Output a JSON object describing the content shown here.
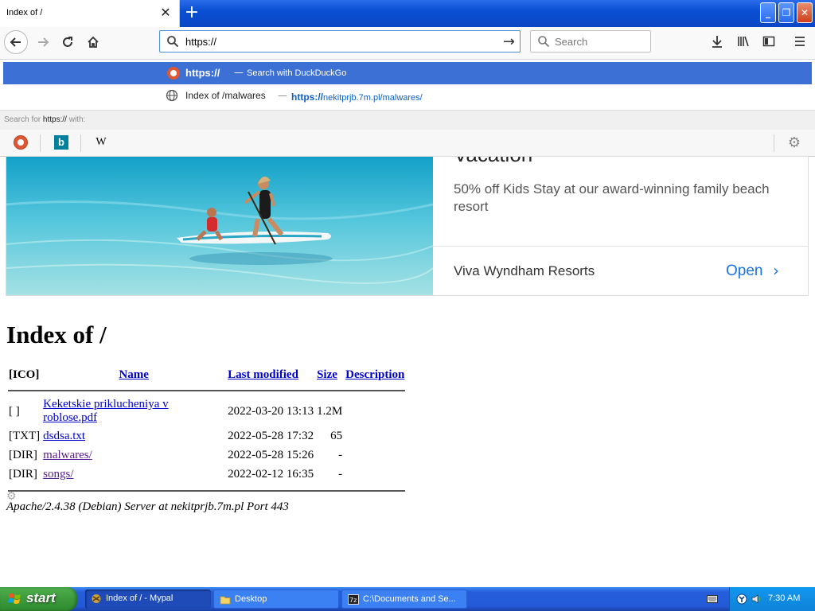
{
  "browser": {
    "tab_title": "Index of /",
    "tab_close": "✕",
    "new_tab": "+",
    "url_value": "https://",
    "search_placeholder": "Search"
  },
  "url_dropdown": {
    "row1_main": "https://",
    "row1_dash": "—",
    "row1_sub": "Search with DuckDuckGo",
    "row2_title": "Index of /malwares",
    "row2_dash": "—",
    "row2_url_bold": "https://",
    "row2_url_rest": "nekitprjb.7m.pl/malwares/",
    "search_for_prefix": "Search for",
    "search_for_query": "https://",
    "search_for_suffix": "with:",
    "engine_wiki": "W"
  },
  "ad": {
    "title_fragment": "Vacation",
    "description": "50% off Kids Stay at our award-winning family beach resort",
    "advertiser": "Viva Wyndham Resorts",
    "cta": "Open",
    "cta_chevron": "›"
  },
  "index": {
    "heading": "Index of /",
    "columns": [
      "[ICO]",
      "Name",
      "Last modified",
      "Size",
      "Description"
    ],
    "rows": [
      {
        "icon": "[ ]",
        "name": "Keketskie priklucheniya v roblose.pdf",
        "modified": "2022-03-20 13:13",
        "size": "1.2M",
        "description": ""
      },
      {
        "icon": "[TXT]",
        "name": "dsdsa.txt",
        "modified": "2022-05-28 17:32",
        "size": "65",
        "description": ""
      },
      {
        "icon": "[DIR]",
        "name": "malwares/",
        "modified": "2022-05-28 15:26",
        "size": "-",
        "description": ""
      },
      {
        "icon": "[DIR]",
        "name": "songs/",
        "modified": "2022-02-12 16:35",
        "size": "-",
        "description": ""
      }
    ],
    "footer": "Apache/2.4.38 (Debian) Server at nekitprjb.7m.pl Port 443"
  },
  "taskbar": {
    "start_label": "start",
    "items": [
      {
        "label": "Index of / - Mypal"
      },
      {
        "label": "Desktop"
      },
      {
        "label": "C:\\Documents and Se..."
      }
    ],
    "clock": "7:30 AM"
  },
  "colors": {
    "xp_blue": "#245edb",
    "url_highlight": "#3d70d4",
    "link_blue": "#0000cc",
    "link_visited": "#551a8b",
    "cta_blue": "#1a73e8"
  }
}
